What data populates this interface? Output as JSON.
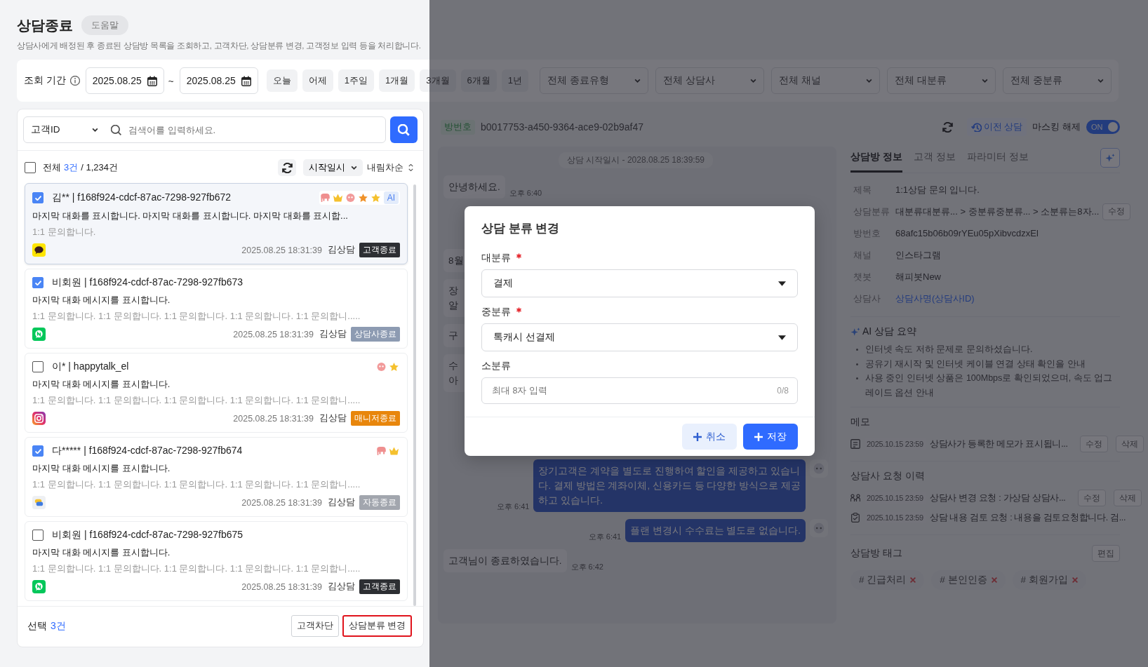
{
  "page": {
    "title": "상담종료",
    "help_button": "도움말",
    "description": "상담사에게 배정된 후 종료된 상담방 목록을 조회하고, 고객차단, 상담분류 변경, 고객정보 입력 등을 처리합니다."
  },
  "filters": {
    "period_label": "조회 기간",
    "start_date": "2025.08.25",
    "separator": "~",
    "end_date": "2025.08.25",
    "ranges": [
      "오늘",
      "어제",
      "1주일",
      "1개월",
      "3개월",
      "6개월",
      "1년"
    ],
    "dropdowns": [
      "전체 종료유형",
      "전체 상담사",
      "전체 채널",
      "전체 대분류",
      "전체 중분류"
    ]
  },
  "search": {
    "type": "고객ID",
    "placeholder": "검색어를 입력하세요."
  },
  "list_header": {
    "all_checked": false,
    "label": "전체",
    "count": "3건",
    "total": "/ 1,234건",
    "sort_field": "시작일시",
    "sort_order": "내림차순"
  },
  "sessions": [
    {
      "customer": "김** | f168f924-cdcf-87ac-7298-927fb672",
      "checked": true,
      "selected": true,
      "icons": [
        {
          "kind": "elephant",
          "color": "#ef8f8f"
        },
        {
          "kind": "crown",
          "color": "#f5c12e"
        },
        {
          "kind": "face",
          "color": "#f29a9a"
        },
        {
          "kind": "star",
          "color": "#f0932b"
        },
        {
          "kind": "star",
          "color": "#f5c12e"
        }
      ],
      "ai_badge": "AI",
      "message": "마지막 대화를 표시합니다.  마지막 대화를 표시합니다. 마지막 대화를 표시합...",
      "summary": "1:1 문의합니다.",
      "channel": {
        "kind": "kakaotalk"
      },
      "datetime": "2025.08.25 18:31:39",
      "agent": "김상담",
      "status": {
        "label": "고객종료",
        "color": "#2d2f33"
      }
    },
    {
      "customer": "비회원 | f168f924-cdcf-87ac-7298-927fb673",
      "checked": true,
      "selected": false,
      "message": "마지막 대화 메시지를 표시합니다.",
      "summary": "1:1 문의합니다. 1:1 문의합니다. 1:1 문의합니다. 1:1 문의합니다. 1:1 문의합니.....",
      "channel": {
        "kind": "navertalk"
      },
      "datetime": "2025.08.25 18:31:39",
      "agent": "김상담",
      "status": {
        "label": "상담사종료",
        "color": "#8d9bb2"
      }
    },
    {
      "customer": "이* | happytalk_el",
      "checked": false,
      "selected": false,
      "icons": [
        {
          "kind": "face",
          "color": "#f29a9a"
        },
        {
          "kind": "star",
          "color": "#f5c12e"
        }
      ],
      "message": "마지막 대화 메시지를 표시합니다.",
      "summary": "1:1 문의합니다. 1:1 문의합니다. 1:1 문의합니다. 1:1 문의합니다. 1:1 문의합니.....",
      "channel": {
        "kind": "instagram"
      },
      "datetime": "2025.08.25 18:31:39",
      "agent": "김상담",
      "status": {
        "label": "매니저종료",
        "color": "#e8860c"
      }
    },
    {
      "customer": "다***** | f168f924-cdcf-87ac-7298-927fb674",
      "checked": true,
      "selected": false,
      "icons": [
        {
          "kind": "elephant",
          "color": "#ef8f8f"
        },
        {
          "kind": "crown",
          "color": "#f5c12e"
        }
      ],
      "message": "마지막 대화 메시지를 표시합니다.",
      "summary": "1:1 문의합니다. 1:1 문의합니다. 1:1 문의합니다. 1:1 문의합니다. 1:1 문의합니.....",
      "channel": {
        "kind": "chat"
      },
      "datetime": "2025.08.25 18:31:39",
      "agent": "김상담",
      "status": {
        "label": "자동종료",
        "color": "#a2a6ae"
      }
    },
    {
      "customer": "비회원 | f168f924-cdcf-87ac-7298-927fb675",
      "checked": false,
      "selected": false,
      "message": "마지막 대화 메시지를 표시합니다.",
      "summary": "1:1 문의합니다. 1:1 문의합니다. 1:1 문의합니다. 1:1 문의합니다. 1:1 문의합니.....",
      "channel": {
        "kind": "navertalk"
      },
      "datetime": "2025.08.25 18:31:39",
      "agent": "김상담",
      "status": {
        "label": "고객종료",
        "color": "#2d2f33"
      }
    }
  ],
  "list_footer": {
    "label": "선택",
    "count": "3건",
    "buttons": [
      {
        "label": "고객차단",
        "highlighted": false
      },
      {
        "label": "상담분류 변경",
        "highlighted": true
      }
    ]
  },
  "room_header": {
    "tag": "방번호",
    "room_id": "b0017753-a450-9364-ace9-02b9af47",
    "history_button": "이전 상담",
    "masking_label": "마스킹 해제",
    "masking_toggle": {
      "on": true,
      "label": "ON"
    }
  },
  "chat": {
    "start_notice": "상담 시작일시 - 2028.08.25 18:39:59",
    "messages": [
      {
        "kind": "customer",
        "lines": [
          "안녕하세요."
        ],
        "time": "오후 6:40"
      },
      {
        "kind": "customer",
        "lines": [
          "8월"
        ]
      },
      {
        "kind": "customer",
        "lines": [
          "장",
          "알"
        ]
      },
      {
        "kind": "customer",
        "lines": [
          "구"
        ]
      },
      {
        "kind": "customer",
        "lines": [
          "수",
          "아"
        ]
      },
      {
        "kind": "agent",
        "lines": [
          "장기고객은 계약을 별도로 진행하여 할인을 제공하고 있습니",
          "다.  결제 방법은 계좌이체, 신용카드 등 다양한 방식으로 제공",
          "하고 있습니다."
        ],
        "time": "오후 6:41"
      },
      {
        "kind": "agent",
        "lines": [
          "플랜 변경시 수수료는 별도로 없습니다."
        ],
        "time": "오후 6:41"
      },
      {
        "kind": "customer",
        "lines": [
          "고객님이 종료하였습니다."
        ],
        "time": "오후 6:42"
      }
    ]
  },
  "info_panel": {
    "tabs": [
      {
        "label": "상담방 정보",
        "selected": true
      },
      {
        "label": "고객 정보",
        "selected": false
      },
      {
        "label": "파라미터 정보",
        "selected": false
      }
    ],
    "fields": [
      {
        "label": "제목",
        "value": "1:1상담 문의 입니다.",
        "kind": "text"
      },
      {
        "label": "상담분류",
        "value": "대분류대분류... > 중분류중분류... > 소분류는8자...",
        "kind": "text",
        "action": "수정"
      },
      {
        "label": "방번호",
        "value": "68afc15b06b09rYEu05pXibvcdzxEl",
        "kind": "text"
      },
      {
        "label": "채널",
        "value": "인스타그램",
        "kind": "text"
      },
      {
        "label": "챗봇",
        "value": "해피봇New",
        "kind": "text"
      },
      {
        "label": "상담사",
        "value": "상담사명(상담사ID)",
        "kind": "link"
      }
    ],
    "ai_summary": {
      "title": "AI 상담 요약",
      "items": [
        "인터넷 속도 저하 문제로 문의하셨습니다.",
        "공유기 재시작 및 인터넷 케이블 연결 상태 확인을 안내",
        "사용 중인 인터넷 상품은 100Mbps로 확인되었으며, 속도 업그레이드 옵션 안내"
      ]
    },
    "memo": {
      "title": "메모",
      "items": [
        {
          "kind": "memo",
          "date": "2025.10.15 23:59",
          "text": "상담사가 등록한 메모가 표시됩니...",
          "actions": [
            "수정",
            "삭제"
          ]
        }
      ]
    },
    "requests": {
      "title": "상담사 요청 이력",
      "items": [
        {
          "kind": "transfer",
          "date": "2025.10.15 23:59",
          "text": "상담사 변경 요청 : 가상담 상담사...",
          "actions": [
            "수정",
            "삭제"
          ]
        },
        {
          "kind": "review",
          "date": "2025.10.15 23:59",
          "text": "상담 내용 검토 요청 : 내용을 검토요청합니다. 검..."
        }
      ]
    },
    "tags": {
      "title": "상담방 태그",
      "edit_button": "편집",
      "items": [
        "# 긴급처리",
        "# 본인인증",
        "# 회원가입"
      ]
    }
  },
  "modal": {
    "title": "상담 분류 변경",
    "fields": [
      {
        "label": "대분류",
        "required": true,
        "kind": "select",
        "value": "결제"
      },
      {
        "label": "중분류",
        "required": true,
        "kind": "select",
        "value": "톡캐시 선결제"
      },
      {
        "label": "소분류",
        "required": false,
        "kind": "text",
        "placeholder": "최대 8자 입력",
        "counter": "0/8"
      }
    ],
    "buttons": [
      {
        "label": "취소",
        "kind": "secondary"
      },
      {
        "label": "저장",
        "kind": "primary"
      }
    ]
  }
}
